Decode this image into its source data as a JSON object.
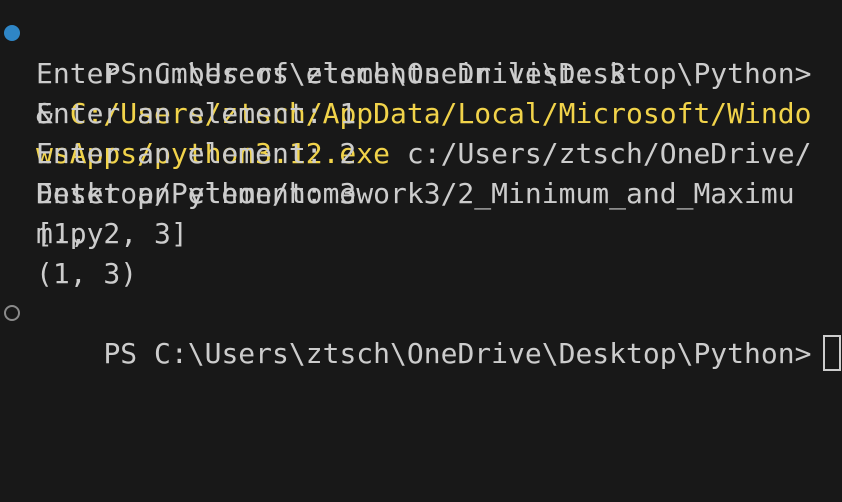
{
  "terminal": {
    "command_prompt": "PS C:\\Users\\ztsch\\OneDrive\\Desktop\\Python> ",
    "command_operator": "& ",
    "exe_path": "C:/Users/ztsch/AppData/Local/Microsoft/WindowsApps/python3.12.exe",
    "script_path": " c:/Users/ztsch/OneDrive/Desktop/Python/homework3/2_Minimum_and_Maximum.py",
    "output_lines": [
      "Enter number of elements in list: 3",
      "Enter an element: 1",
      "Enter an element: 2",
      "Enter an element: 3",
      "[1, 2, 3]",
      "(1, 3)"
    ],
    "current_prompt": "PS C:\\Users\\ztsch\\OneDrive\\Desktop\\Python>",
    "colors": {
      "background": "#181818",
      "text": "#cccccc",
      "executable": "#f1d34a",
      "success_decoration": "#2f86c6",
      "pending_decoration": "#8a8a8a"
    }
  }
}
